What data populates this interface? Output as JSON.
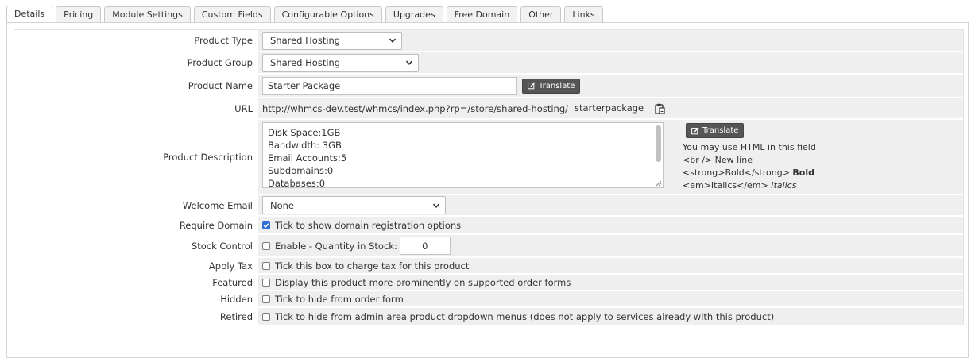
{
  "tabs": [
    "Details",
    "Pricing",
    "Module Settings",
    "Custom Fields",
    "Configurable Options",
    "Upgrades",
    "Free Domain",
    "Other",
    "Links"
  ],
  "active_tab": "Details",
  "fields": {
    "product_type": {
      "label": "Product Type",
      "value": "Shared Hosting"
    },
    "product_group": {
      "label": "Product Group",
      "value": "Shared Hosting"
    },
    "product_name": {
      "label": "Product Name",
      "value": "Starter Package",
      "translate": "Translate"
    },
    "url": {
      "label": "URL",
      "base": "http://whmcs-dev.test/whmcs/index.php?rp=/store/shared-hosting/",
      "slug": "starterpackage"
    },
    "product_description": {
      "label": "Product Description",
      "lines": [
        "Disk Space:1GB",
        "Bandwidth: 3GB",
        "Email Accounts:5",
        "Subdomains:0",
        "Databases:0"
      ],
      "translate": "Translate",
      "help": [
        "You may use HTML in this field",
        "<br /> New line",
        "<strong>Bold</strong>",
        "Bold",
        "<em>Italics</em>",
        "Italics"
      ]
    },
    "welcome_email": {
      "label": "Welcome Email",
      "value": "None"
    },
    "require_domain": {
      "label": "Require Domain",
      "text": "Tick to show domain registration options",
      "checked": true
    },
    "stock_control": {
      "label": "Stock Control",
      "text": "Enable - Quantity in Stock:",
      "checked": false,
      "quantity": "0"
    },
    "apply_tax": {
      "label": "Apply Tax",
      "text": "Tick this box to charge tax for this product",
      "checked": false
    },
    "featured": {
      "label": "Featured",
      "text": "Display this product more prominently on supported order forms",
      "checked": false
    },
    "hidden": {
      "label": "Hidden",
      "text": "Tick to hide from order form",
      "checked": false
    },
    "retired": {
      "label": "Retired",
      "text": "Tick to hide from admin area product dropdown menus (does not apply to services already with this product)",
      "checked": false
    }
  },
  "colors": {
    "checkbox_checked": "#2f6fd6",
    "field_bg": "#efefef",
    "translate_btn": "#555555"
  }
}
